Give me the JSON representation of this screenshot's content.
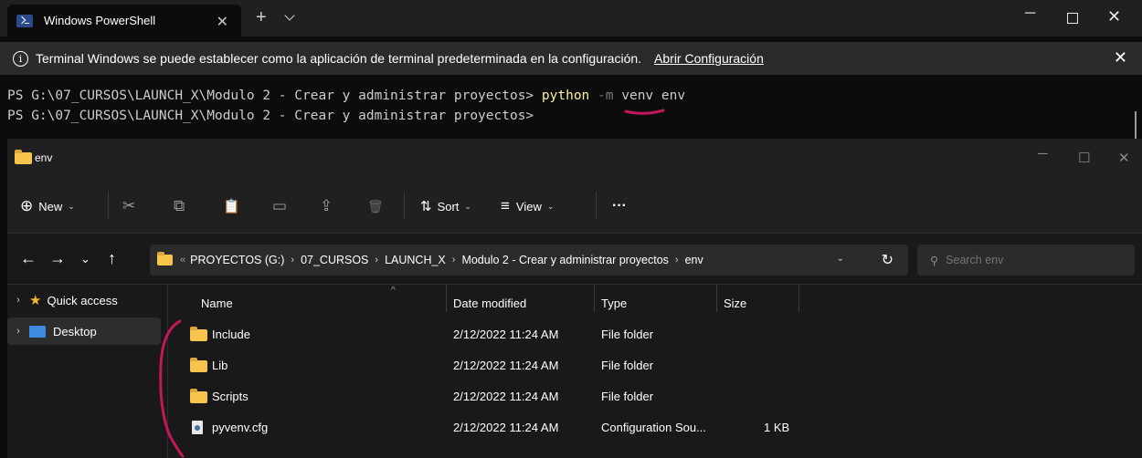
{
  "terminal": {
    "tab_title": "Windows PowerShell",
    "tab_close": "✕",
    "new_tab": "+",
    "win_min": "─",
    "win_close": "✕",
    "info_icon": "i",
    "info_text": "Terminal Windows se puede establecer como la aplicación de terminal predeterminada en la configuración.",
    "info_link": "Abrir Configuración",
    "info_close": "✕",
    "prompt": "PS G:\\07_CURSOS\\LAUNCH_X\\Modulo 2 - Crear y administrar proyectos> ",
    "cmd": "python",
    "cmd_flag": " -m",
    "cmd_args": " venv env",
    "prompt2": "PS G:\\07_CURSOS\\LAUNCH_X\\Modulo 2 - Crear y administrar proyectos>"
  },
  "explorer": {
    "title": "env",
    "win_min": "─",
    "win_max": "☐",
    "win_close": "✕",
    "toolbar": {
      "new_icon": "⊕",
      "new_label": "New",
      "cut_icon": "✂",
      "copy_icon": "⧉",
      "paste_icon": "📋",
      "rename_icon": "▭",
      "share_icon": "⇪",
      "delete_icon": "🗑",
      "sort_icon": "⇅",
      "sort_label": "Sort",
      "view_icon": "≡",
      "view_label": "View",
      "more_label": "···",
      "chevron": "⌄"
    },
    "nav": {
      "back": "←",
      "forward": "→",
      "recent": "⌄",
      "up": "↑"
    },
    "breadcrumb": {
      "lead": "«",
      "items": [
        "PROYECTOS (G:)",
        "07_CURSOS",
        "LAUNCH_X",
        "Modulo 2 - Crear y administrar proyectos",
        "env"
      ],
      "sep": "›"
    },
    "addr_dropdown": "⌄",
    "refresh": "↻",
    "search": {
      "icon": "⚲",
      "placeholder": "Search env"
    },
    "sidebar": [
      {
        "label": "Quick access",
        "arrow": "›"
      },
      {
        "label": "Desktop",
        "arrow": "›"
      }
    ],
    "columns": {
      "name": "Name",
      "sort_arrow": "^",
      "date": "Date modified",
      "type": "Type",
      "size": "Size"
    },
    "files": [
      {
        "name": "Include",
        "date": "2/12/2022 11:24 AM",
        "type": "File folder",
        "size": "",
        "kind": "folder"
      },
      {
        "name": "Lib",
        "date": "2/12/2022 11:24 AM",
        "type": "File folder",
        "size": "",
        "kind": "folder"
      },
      {
        "name": "Scripts",
        "date": "2/12/2022 11:24 AM",
        "type": "File folder",
        "size": "",
        "kind": "folder"
      },
      {
        "name": "pyvenv.cfg",
        "date": "2/12/2022 11:24 AM",
        "type": "Configuration Sou...",
        "size": "1 KB",
        "kind": "file"
      }
    ]
  },
  "colors": {
    "annotation": "#c2185b",
    "folder": "#f8c54c",
    "python_cmd": "#f9f1a5"
  }
}
